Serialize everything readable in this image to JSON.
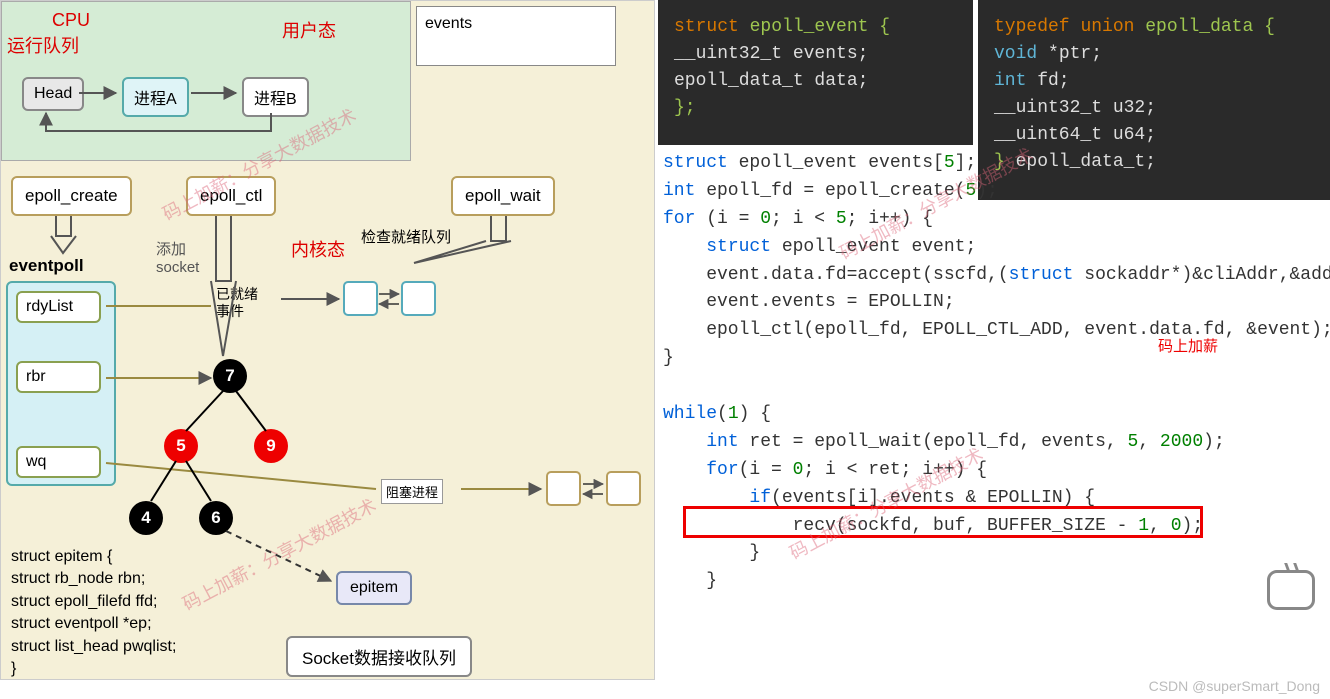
{
  "diagram": {
    "cpu_label": "CPU",
    "cpu_queue": "运行队列",
    "user_state": "用户态",
    "kernel_state": "内核态",
    "events": "events",
    "head": "Head",
    "proc_a": "进程A",
    "proc_b": "进程B",
    "epoll_create": "epoll_create",
    "epoll_ctl": "epoll_ctl",
    "epoll_wait": "epoll_wait",
    "eventpoll": "eventpoll",
    "rdylist": "rdyList",
    "rbr": "rbr",
    "wq": "wq",
    "add_socket_l1": "添加",
    "add_socket_l2": "socket",
    "check_ready": "检查就绪队列",
    "ready_event_l1": "已就绪",
    "ready_event_l2": "事件",
    "block_proc": "阻塞进程",
    "tree": {
      "n7": "7",
      "n5": "5",
      "n9": "9",
      "n4": "4",
      "n6": "6"
    },
    "epitem": "epitem",
    "struct_lines": [
      "struct epitem {",
      "  struct rb_node rbn;",
      "  struct epoll_filefd ffd;",
      "  struct eventpoll *ep;",
      "  struct list_head pwqlist;",
      "}"
    ],
    "socket_queue": "Socket数据接收队列",
    "watermark": "码上加薪：分享大数据技术"
  },
  "code": {
    "dark1": {
      "l1_kw": "struct",
      "l1_rest": " epoll_event {",
      "l2": "    __uint32_t events;",
      "l3": "    epoll_data_t data;",
      "l4": "};"
    },
    "dark2": {
      "l1_kw": "typedef",
      "l1_kw2": "union",
      "l1_rest": " epoll_data {",
      "l2_kw": "void",
      "l2_rest": " *ptr;",
      "l3_kw": "int",
      "l3_rest": " fd;",
      "l4": "    __uint32_t u32;",
      "l5": "    __uint64_t u64;",
      "l6_a": "}",
      "l6_b": " epoll_data_t;"
    },
    "light": {
      "l1": "struct epoll_event events[5];",
      "l2": "int epoll_fd = epoll_create(5);",
      "l3": "for (i = 0; i < 5; i++) {",
      "l4": "    struct epoll_event event;",
      "l5": "    event.data.fd=accept(sscfd,(struct sockaddr*)&cliAddr,&addrLen)",
      "l6": "    event.events = EPOLLIN;",
      "l7": "    epoll_ctl(epoll_fd, EPOLL_CTL_ADD, event.data.fd, &event);",
      "l8": "}",
      "blank": "",
      "l9": "while(1) {",
      "l10": "    int ret = epoll_wait(epoll_fd, events, 5, 2000);",
      "l11": "    for(i = 0; i < ret; i++) {",
      "l12": "        if(events[i].events & EPOLLIN) {",
      "l13": "            recv(sockfd, buf, BUFFER_SIZE - 1, 0);",
      "l14": "        }",
      "l15": "    }"
    },
    "red_annot": "码上加薪"
  },
  "footer": "CSDN @superSmart_Dong"
}
